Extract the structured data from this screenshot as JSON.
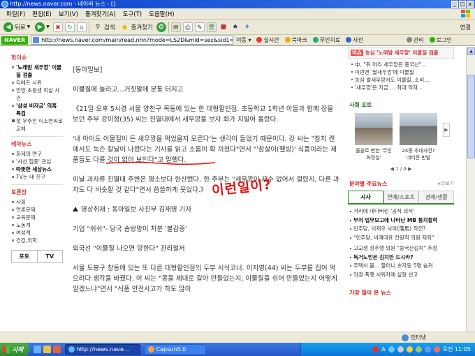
{
  "window": {
    "title": "http://news.naver.com - 네이버 뉴스 - []",
    "min_glyph": "_",
    "max_glyph": "□",
    "close_glyph": "x"
  },
  "menu": [
    "파일(F)",
    "편집(E)",
    "보기(V)",
    "즐겨찾기(A)",
    "도구(T)",
    "도움말(H)"
  ],
  "toolbar": {
    "back_label": "뒤로",
    "search_label": "검색",
    "favorites_label": "즐겨찾기",
    "right_label": "연결"
  },
  "addressbar": {
    "brand": "NAVER",
    "url": "http://news.naver.com/main/read.nhn?mode=LS2D&mid=sec&sid1=10",
    "go_label": "이동",
    "links": [
      "실시간",
      "북마크",
      "무인치료",
      "사전",
      "관리",
      "로그인"
    ]
  },
  "leftnav": {
    "section1_title": "핫이슈",
    "section1_items": [
      {
        "text": "'노래방 새우깡' 이물질 검출",
        "bold": true
      },
      {
        "text": "티베트 시위",
        "bold": false
      },
      {
        "text": "안양 초등생 피살 사건",
        "bold": false
      },
      {
        "text": "'삼성 비자금' 의혹 특검",
        "bold": true
      },
      {
        "text": "첫 우주인 이소연씨로 교체",
        "bold": false,
        "img": true
      }
    ],
    "section2_title": "테마뉴스",
    "section2_items": [
      {
        "text": "화제의 연구",
        "bold": false
      },
      {
        "text": "'시선 집중' 관심",
        "bold": false
      },
      {
        "text": "따뜻한 세상뉴스",
        "bold": true
      },
      {
        "text": "TV는 내 친구",
        "bold": false
      }
    ],
    "section3_title": "토론장",
    "section3_items": [
      "사회",
      "언론문제",
      "교육문제",
      "노동계",
      "여성계",
      "건강,의학"
    ],
    "bottom_tabs": [
      "포토",
      "TV"
    ]
  },
  "article": {
    "source": "[동아일보]",
    "headline": "이물질에 놀라고…거짓말에 분통 터지고",
    "p1": "《21일 오후 5시경 서울 양천구 목동에 있는 한 대형할인점. 초등학교 1학년 아들과 함께 장을 보던 주부 강미정(35) 씨는 진열대에서 새우깡을 보자 화가 치밀어 올랐다.",
    "p2": "'내 아이도 이물질이 든 새우깡을 먹었을지 모른다'는 생각이 들었기 때문이다. 강 씨는 \"참치 캔에서도 녹슨 칼날이 나왔다는 기사를 읽고 소름이 확 끼쳤다\"면서 \"'참살이(웰빙)' 식품이라는 제품들도 다를 것이 없어 보인다\"고 말했다.",
    "p3": "이날 과자류 진열대 주변은 평소보다 한산했다. 한 주부는 \"새우깡이 재수 없어서 걸렸지, 다른 과자도 다 비슷할 것 같다\"면서 씁쓸하게 웃었다.》",
    "p4": "영상취재 : 동아일보 사진부 김재명 기자",
    "p5": "기업 \"쉬쉬\"- 당국 솜방망이 처분 '불감증'",
    "p6": "외국선 \"이물질 나오면 망한다\" 관리철저",
    "p7": "서울 도봉구 창동에 있는 또 다른 대형할인점의 두부 시식코너. 이지영(44) 씨는 두부를 집어 먹으려다 생각을 바꿨다. 이 씨는 \"콩을 제대로 갈아 만들었는지, 이물질을 섞어 만들었는지 어떻게 알겠느냐\"면서 \"식품 안전사고가 하도 많이",
    "annotation": "이런일이?"
  },
  "rightcol": {
    "issue_tag": "이슈",
    "issue_title": "농심 '노래방 새우깡' 이물질 검출",
    "issue_items": [
      "中, \"쥐 머리 새우깡은 중국산\"...",
      "이번엔 '쌀새우깡'에 이물질",
      "농심 쌀새우깡서도 이물질..소비...",
      "'새우깡'은 지금 ... 최대 악재..."
    ],
    "photo_title": "사회 포토",
    "photos": [
      {
        "caption": "줄을로 변한 '무인 화장실'"
      },
      {
        "caption": "24중 추대사건? 네티즌 반발"
      }
    ],
    "photo_pager": "1 / 4",
    "biz_title": "분야별 주요뉴스",
    "more_label": "더보기",
    "tabs": [
      "시사",
      "연예/스포츠",
      "경제/생활"
    ],
    "biz_items": [
      {
        "text": "거리에 내다버린 '공직 의식'",
        "bold": false
      },
      {
        "text": "부처 업무보고에 나타난 MB 통치철학",
        "bold": true
      },
      {
        "text": "민주당, 이재오 낙마(落馬) 작전?",
        "bold": false
      },
      {
        "text": "\"민주당, 비례대표 전원적 의원 제외\"",
        "bold": false
      },
      {
        "text": "",
        "gap": true
      },
      {
        "text": "고교생 성추행 의원 \"중국산김치\" 추정",
        "bold": false
      },
      {
        "text": "독거노인은 김치만 드시라?",
        "bold": true
      },
      {
        "text": "주택서 불... 할머니 손자등 5명 숨져",
        "bold": false
      },
      {
        "text": "의경 폭행 시위자에 실형 선고",
        "bold": false
      }
    ],
    "next_section": "가장 많이 본 뉴스"
  },
  "statusbar": {
    "zone": "인터넷"
  },
  "taskbar": {
    "start": "시작",
    "tasks": [
      "http://news.nave...",
      "Capsun5.0"
    ],
    "tray_lang": "A",
    "clock": "오전 11:05"
  }
}
